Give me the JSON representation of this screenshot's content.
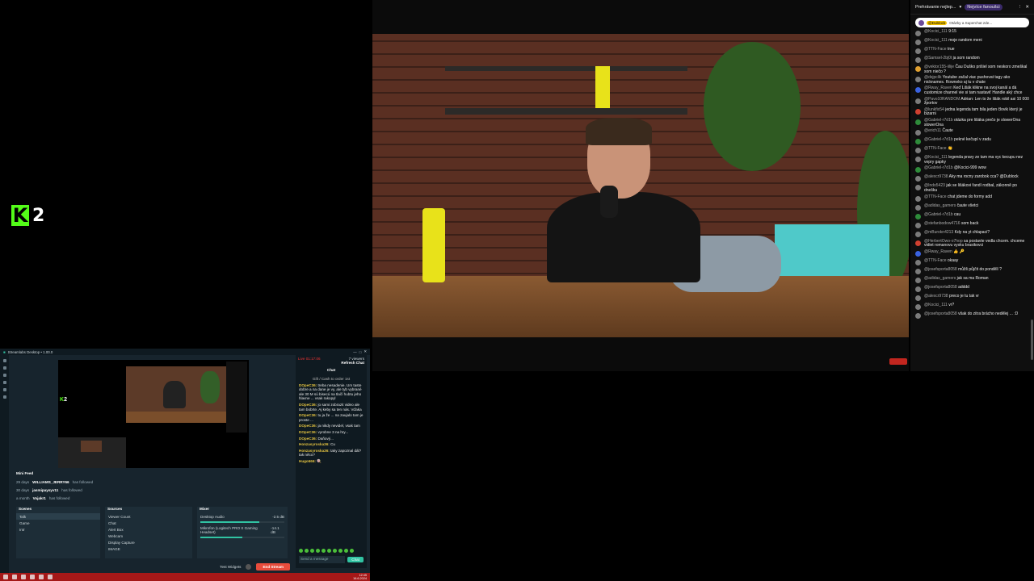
{
  "stream_logo": {
    "letter": "K",
    "number": "2",
    "color": "#53fc18"
  },
  "chat_panel": {
    "title": "Prehrávanie nejlep...",
    "filter": "Nejvíce fanoušci",
    "pinned": {
      "user": "@Dublock",
      "text": "Otázky a Superchat zde..."
    },
    "messages": [
      {
        "user": "@Kocici_111",
        "text": "9:15",
        "color": "#7b7b7b"
      },
      {
        "user": "@Kocici_111",
        "text": "moje random meni",
        "color": "#7b7b7b"
      },
      {
        "user": "@TTN-Face",
        "text": "true",
        "color": "#7b7b7b"
      },
      {
        "user": "@Samsel-2bj0t",
        "text": "ja som random",
        "color": "#7b7b7b"
      },
      {
        "user": "@vektor155-iilije",
        "text": "Čau Duško prišiel som neskoro zmeškal som niečo ?",
        "color": "#e0a030"
      },
      {
        "user": "@dsjpclik",
        "text": "Youtube začal viac pushovat tagy ako nicknames. Rowneko aj tu v chate",
        "color": "#7b7b7b"
      },
      {
        "user": "@Rway_Raven",
        "text": "Keď Lišák kliknе na svoj kanál a dá customize channel vie si tam nastaviť Handle aký chce",
        "color": "#3a62e0"
      },
      {
        "user": "@Pavo10RANDOM",
        "text": "Adrian: Len to že lišák robil asi 10 000 žportov",
        "color": "#7b7b7b"
      },
      {
        "user": "@lunkfix54",
        "text": "jedna legenda tam bila jeden človik který je bizarni",
        "color": "#d04030"
      },
      {
        "user": "@Gabriel-r7d1b",
        "text": "otázka pre lišáka prečo je slowerOna slowerOna",
        "color": "#2e8b3a"
      },
      {
        "user": "@erich11",
        "text": "Čaute",
        "color": "#7b7b7b"
      },
      {
        "user": "@Gabriel-r7d1b",
        "text": "pekné kečupí v zadu",
        "color": "#2e8b3a"
      },
      {
        "user": "@TTN-Face",
        "text": "👏",
        "color": "#7b7b7b"
      },
      {
        "user": "@Kocici_111",
        "text": "legenda pravy ze tam ma vyc kecupu nez vepry gapky",
        "color": "#7b7b7b"
      },
      {
        "user": "@Gabriel-r7d1b",
        "text": "@Kocici-999 wow",
        "color": "#2e8b3a"
      },
      {
        "user": "@alexcr9738",
        "text": "Aky ma rocny zarobok cca? @Dublock",
        "color": "#7b7b7b"
      },
      {
        "user": "@Indo5423",
        "text": "jak se lišákovi řandí rodbal, zákonně po dnešku",
        "color": "#7b7b7b"
      },
      {
        "user": "@TTN-Face",
        "text": "chat jdeme do formy add",
        "color": "#7b7b7b"
      },
      {
        "user": "@adidas_gamers",
        "text": "čaute všetci",
        "color": "#7b7b7b"
      },
      {
        "user": "@Gabriel-r7d1b",
        "text": "cau",
        "color": "#2e8b3a"
      },
      {
        "user": "@stefanbodow4716",
        "text": "som back",
        "color": "#7b7b7b"
      },
      {
        "user": "@mBurokn4213",
        "text": "Kdy na yt chlapaci?",
        "color": "#7b7b7b"
      },
      {
        "user": "@HerbertOwo-o7hop",
        "text": "sa postavte vedla chcem. chceme vidiet romanovu vysku brasikovci",
        "color": "#d04030"
      },
      {
        "user": "@Rway_Raven",
        "text": "👍 🔑",
        "color": "#3a62e0"
      },
      {
        "user": "@TTN-Face",
        "text": "okaay",
        "color": "#7b7b7b"
      },
      {
        "user": "@josefsporta8058",
        "text": "můžš půjčit do pondělí ?",
        "color": "#7b7b7b"
      },
      {
        "user": "@adidas_gamers",
        "text": "jak sa ma Roman",
        "color": "#7b7b7b"
      },
      {
        "user": "@josefsporta8058",
        "text": "adddd",
        "color": "#7b7b7b"
      },
      {
        "user": "@alexcr9738",
        "text": "preco je tu tak vr",
        "color": "#7b7b7b"
      },
      {
        "user": "@Kocici_111",
        "text": "vr?",
        "color": "#7b7b7b"
      },
      {
        "user": "@josefsporta8058",
        "text": "však do zitra brácho nedělej ... :D",
        "color": "#7b7b7b"
      }
    ]
  },
  "app": {
    "title": "Streamlabs Desktop • 1.00.0",
    "preview_logo": {
      "letter": "K",
      "number": "2"
    },
    "mini_feed": {
      "title": "Mini Feed",
      "items": [
        {
          "time": "29 days",
          "user": "WILLIAMS_JERRY66",
          "action": "has followed"
        },
        {
          "time": "30 days",
          "user": "jasmipaysyv11",
          "action": "has followed"
        },
        {
          "time": "a month",
          "user": "Vojakr1",
          "action": "has followed"
        }
      ]
    },
    "scenes": {
      "title": "Scenes",
      "items": [
        "Talk",
        "Game",
        "Intr"
      ]
    },
    "sources": {
      "title": "Sources",
      "items": [
        "Viewer Count",
        "Chat",
        "Alert Box",
        "Webcam",
        "Display Capture",
        "IMAGE"
      ]
    },
    "mixer": {
      "title": "Mixer",
      "items": [
        {
          "name": "Desktop Audio",
          "db": "-2.5 dB",
          "level": 0.7
        },
        {
          "name": "Mikrofon (Logitech PRO X Gaming Headset)",
          "db": "-14.1 dB",
          "level": 0.5
        }
      ]
    },
    "test_widgets": "Test Widgets",
    "go_live": "End Stream",
    "chat": {
      "status": "Live 01:17:06",
      "viewers": "7 viewers",
      "refresh": "Refresh Chat",
      "title": "Chat",
      "banner": "Gift / Cash to order 1st",
      "messages": [
        {
          "user": "DOpeC36:",
          "text": "treba nesadenie. Um taste dobre a na dane je vy, ale tyb vybrané ale 30 M sú bisecú na tlačí hubtu jeho hlavne ... vsak rakopyl"
        },
        {
          "user": "DOpeC36:",
          "text": "jo sami zobrazit video ale tam bobrte. Aj keby sa ten nás. Vďaka"
        },
        {
          "user": "DOpeC36:",
          "text": "tu ja že ... na zaujalo tam je proste ..."
        },
        {
          "user": "DOpeC36:",
          "text": "ja nikdy nevidel, vsak tam"
        },
        {
          "user": "DOpeC36:",
          "text": "vyrobne 3 na hry..."
        },
        {
          "user": "DOpeC36:",
          "text": "Daňový..."
        },
        {
          "user": "Honzasyroska36:",
          "text": "Cu"
        },
        {
          "user": "Honzasyroska36:",
          "text": "taky zapoznal dál? tak něco?"
        },
        {
          "user": "Hugo666:",
          "text": "🍭"
        }
      ],
      "input_placeholder": "Send a message",
      "send": "Chat"
    },
    "taskbar_clock": "12:45\n16.6.2024"
  }
}
